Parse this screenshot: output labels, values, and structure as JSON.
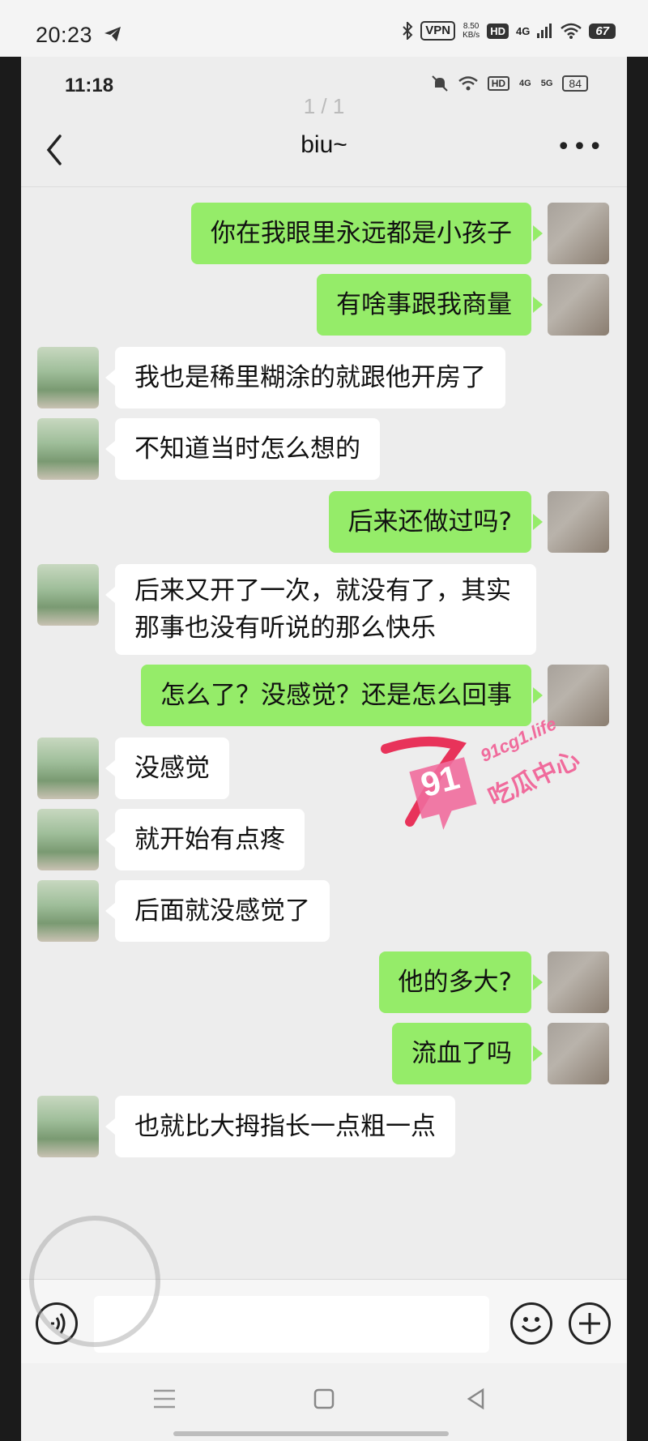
{
  "outer_status": {
    "time": "20:23",
    "vpn": "VPN",
    "net_speed_value": "8.50",
    "net_speed_unit": "KB/s",
    "hd": "HD",
    "signal": "4G",
    "battery": "67"
  },
  "inner_status": {
    "time": "11:18",
    "hd": "HD",
    "sig1": "4G",
    "sig2": "5G",
    "battery": "84"
  },
  "page_indicator": "1 / 1",
  "nav": {
    "title": "biu~"
  },
  "messages": [
    {
      "side": "right",
      "text": "你在我眼里永远都是小孩子"
    },
    {
      "side": "right",
      "text": "有啥事跟我商量"
    },
    {
      "side": "left",
      "text": "我也是稀里糊涂的就跟他开房了"
    },
    {
      "side": "left",
      "text": "不知道当时怎么想的"
    },
    {
      "side": "right",
      "text": "后来还做过吗?"
    },
    {
      "side": "left",
      "text": "后来又开了一次，就没有了，其实那事也没有听说的那么快乐"
    },
    {
      "side": "right",
      "text": "怎么了？没感觉？还是怎么回事"
    },
    {
      "side": "left",
      "text": "没感觉"
    },
    {
      "side": "left",
      "text": "就开始有点疼"
    },
    {
      "side": "left",
      "text": "后面就没感觉了"
    },
    {
      "side": "right",
      "text": "他的多大?"
    },
    {
      "side": "right",
      "text": "流血了吗"
    },
    {
      "side": "left",
      "text": "也就比大拇指长一点粗一点"
    }
  ],
  "watermark": {
    "number": "91",
    "site": "91cg1.life",
    "name": "吃瓜中心"
  },
  "icons": {
    "back": "chevron-left-icon",
    "more": "more-dots-icon",
    "voice": "voice-icon",
    "emoji": "emoji-icon",
    "plus": "plus-icon"
  }
}
